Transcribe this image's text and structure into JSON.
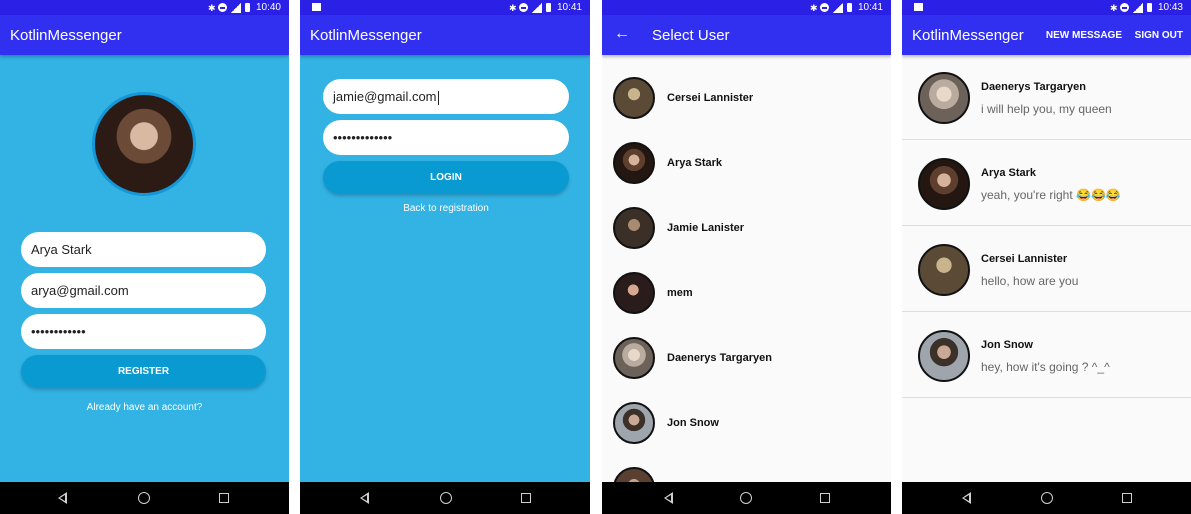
{
  "screens": {
    "register": {
      "time": "10:40",
      "title": "KotlinMessenger",
      "username": "Arya Stark",
      "email": "arya@gmail.com",
      "password": "••••••••••••",
      "button": "REGISTER",
      "link": "Already have an account?"
    },
    "login": {
      "time": "10:41",
      "title": "KotlinMessenger",
      "email": "jamie@gmail.com",
      "password": "•••••••••••••",
      "button": "LOGIN",
      "link": "Back to registration"
    },
    "select_user": {
      "time": "10:41",
      "title": "Select User",
      "users": [
        {
          "name": "Cersei Lannister"
        },
        {
          "name": "Arya Stark"
        },
        {
          "name": "Jamie Lanister"
        },
        {
          "name": "mem"
        },
        {
          "name": "Daenerys Targaryen"
        },
        {
          "name": "Jon Snow"
        }
      ]
    },
    "latest_messages": {
      "time": "10:43",
      "title": "KotlinMessenger",
      "menu_new": "NEW MESSAGE",
      "menu_signout": "SIGN OUT",
      "messages": [
        {
          "name": "Daenerys Targaryen",
          "text": "i will help you, my queen"
        },
        {
          "name": "Arya Stark",
          "text": "yeah, you're right 😂😂😂"
        },
        {
          "name": "Cersei Lannister",
          "text": "hello, how are you"
        },
        {
          "name": "Jon Snow",
          "text": "hey, how it's going ? ^_^"
        }
      ]
    }
  },
  "colors": {
    "status_bar": "#2a20e6",
    "app_bar": "#3130f1",
    "register_bg": "#33b2e4",
    "button": "#0a9ad2",
    "list_bg": "#fafafa"
  }
}
